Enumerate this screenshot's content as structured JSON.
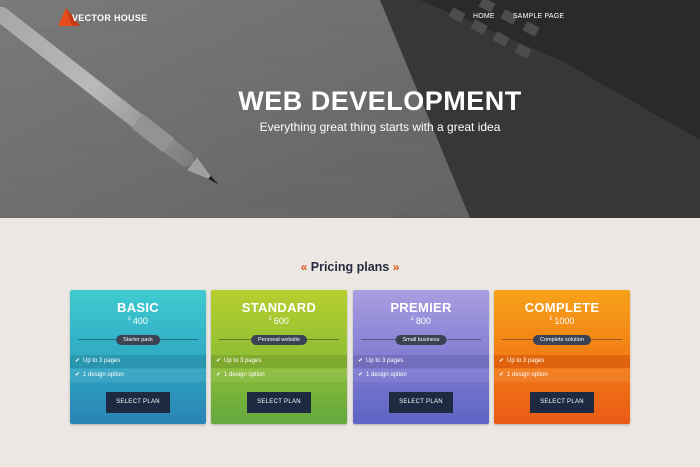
{
  "header": {
    "logo_text": "VECTOR HOUSE",
    "nav": [
      "HOME",
      "SAMPLE PAGE"
    ]
  },
  "hero": {
    "title": "WEB DEVELOPMENT",
    "subtitle": "Everything great thing starts with a great idea"
  },
  "pricing": {
    "quote_open": "«",
    "title": "Pricing plans",
    "quote_close": "»",
    "currency": "£",
    "plans": [
      {
        "name": "BASIC",
        "price": "400",
        "tag": "Starter pack",
        "features": [
          "Up to 3 pages",
          "1 design option"
        ],
        "button": "SELECT PLAN"
      },
      {
        "name": "STANDARD",
        "price": "600",
        "tag": "Personal website",
        "features": [
          "Up to 3 pages",
          "1 design option"
        ],
        "button": "SELECT PLAN"
      },
      {
        "name": "PREMIER",
        "price": "800",
        "tag": "Small business",
        "features": [
          "Up to 3 pages",
          "1 design option"
        ],
        "button": "SELECT PLAN"
      },
      {
        "name": "COMPLETE",
        "price": "1000",
        "tag": "Complete solution",
        "features": [
          "Up to 3 pages",
          "1 design option"
        ],
        "button": "SELECT PLAN"
      }
    ]
  },
  "colors": {
    "accent": "#e0561c",
    "button": "#1d2a42",
    "page_bg": "#ece7e2"
  }
}
